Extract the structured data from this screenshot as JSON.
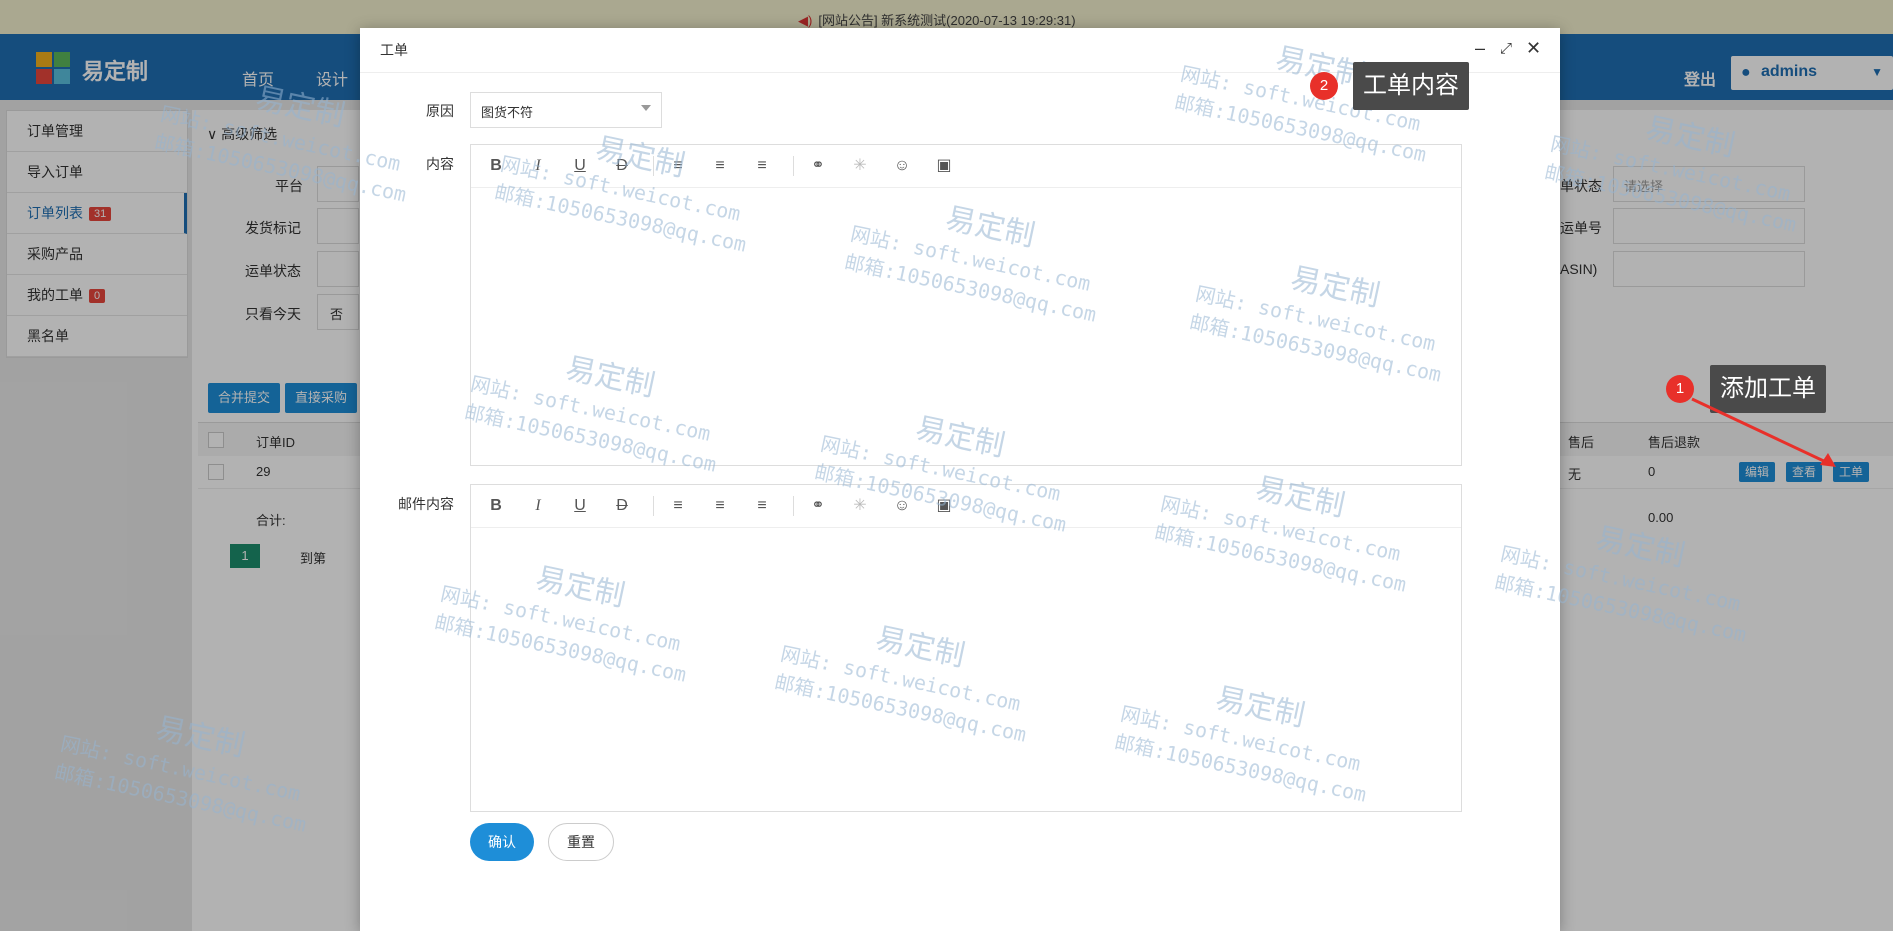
{
  "notice": {
    "text": "[网站公告]  新系统测试(2020-07-13 19:29:31)"
  },
  "header": {
    "logo_text": "易定制",
    "nav": [
      "首页",
      "设计"
    ],
    "logout": "登出",
    "user": "admins"
  },
  "sidebar": {
    "items": [
      {
        "label": "订单管理",
        "badge": ""
      },
      {
        "label": "导入订单",
        "badge": ""
      },
      {
        "label": "订单列表",
        "badge": "31"
      },
      {
        "label": "采购产品",
        "badge": ""
      },
      {
        "label": "我的工单",
        "badge": "0"
      },
      {
        "label": "黑名单",
        "badge": ""
      }
    ]
  },
  "filter": {
    "toggle": "高级筛选",
    "labels": [
      "平台",
      "发货标记",
      "运单状态",
      "只看今天"
    ],
    "today_value": "否",
    "right_labels": [
      "单状态",
      "运单号",
      "ASIN)"
    ],
    "status_placeholder": "请选择"
  },
  "actions": {
    "merge": "合并提交",
    "purchase": "直接采购"
  },
  "table": {
    "headers": [
      "订单ID",
      "售后",
      "售后退款"
    ],
    "row": {
      "id": "29",
      "after_sale": "无",
      "refund": "0",
      "partial": "y"
    },
    "ops": [
      "编辑",
      "查看",
      "工单"
    ],
    "total_label": "合计:",
    "total_value": "0.00"
  },
  "pagination": {
    "current": "1",
    "goto_label": "到第",
    "goto_value": "1"
  },
  "dialog": {
    "title": "工单",
    "reason_label": "原因",
    "reason_value": "图货不符",
    "content_label": "内容",
    "email_label": "邮件内容",
    "confirm": "确认",
    "reset": "重置"
  },
  "callouts": [
    {
      "num": "1",
      "text": "添加工单"
    },
    {
      "num": "2",
      "text": "工单内容"
    }
  ],
  "watermark": {
    "title": "易定制",
    "site": "网站: soft.weicot.com",
    "mail": "邮箱:1050653098@qq.com"
  },
  "colors": {
    "brand": "#1f6fb4",
    "primary_button": "#1e8ed8",
    "badge": "#e8473d"
  }
}
